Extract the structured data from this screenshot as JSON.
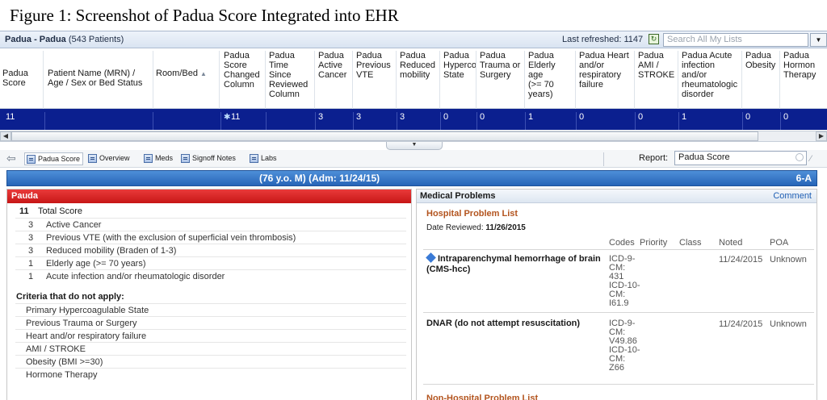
{
  "caption": "Figure 1: Screenshot of Padua Score Integrated into EHR",
  "list": {
    "title": "Padua - Padua",
    "count": "(543 Patients)",
    "last_refreshed_label": "Last refreshed:",
    "last_refreshed_value": "1147",
    "search_placeholder": "Search All My Lists"
  },
  "columns": [
    "Padua\nScore",
    "Patient Name (MRN) /\nAge / Sex or Bed Status",
    "Room/Bed",
    "Padua\nScore\nChanged\nColumn",
    "Padua\nTime\nSince\nReviewed\nColumn",
    "Padua\nActive\nCancer",
    "Padua\nPrevious\nVTE",
    "Padua\nReduced\nmobility",
    "Padua\nHyperco\nState",
    "Padua\nTrauma or\nSurgery",
    "Padua\nElderly age\n(>= 70\nyears)",
    "Padua Heart\nand/or\nrespiratory\nfailure",
    "Padua\nAMI /\nSTROKE",
    "Padua Acute\ninfection\nand/or\nrheumatologic\ndisorder",
    "Padua\nObesity",
    "Padua\nHormon\nTherapy"
  ],
  "row": {
    "score": "11",
    "patient": "",
    "room": "",
    "changed": "11",
    "time_since": "",
    "active_cancer": "3",
    "previous_vte": "3",
    "reduced_mobility": "3",
    "hyperco": "0",
    "trauma": "0",
    "elderly": "1",
    "heart": "0",
    "ami": "0",
    "acute_infection": "1",
    "obesity": "0",
    "hormone": "0"
  },
  "tabs": [
    {
      "label": "Padua Score",
      "active": true
    },
    {
      "label": "Overview"
    },
    {
      "label": "Meds"
    },
    {
      "label": "Signoff Notes"
    },
    {
      "label": "Labs"
    }
  ],
  "report": {
    "label": "Report:",
    "value": "Padua Score"
  },
  "banner": {
    "patient_info": "(76 y.o. M)  (Adm: 11/24/15)",
    "room": "6-A"
  },
  "padua_panel": {
    "title": "Pauda",
    "total_score": "11",
    "total_label": "Total Score",
    "scored_items": [
      {
        "points": "3",
        "label": "Active Cancer"
      },
      {
        "points": "3",
        "label": "Previous VTE (with the exclusion of superficial vein thrombosis)"
      },
      {
        "points": "3",
        "label": "Reduced mobility (Braden of 1-3)"
      },
      {
        "points": "1",
        "label": "Elderly age (>= 70 years)"
      },
      {
        "points": "1",
        "label": "Acute infection and/or rheumatologic disorder"
      }
    ],
    "criteria_not_apply_label": "Criteria that do not apply:",
    "criteria_not_apply": [
      "Primary Hypercoagulable State",
      "Previous Trauma or Surgery",
      "Heart and/or respiratory failure",
      "AMI / STROKE",
      "Obesity (BMI >=30)",
      "Hormone Therapy"
    ]
  },
  "medical_problems": {
    "title": "Medical Problems",
    "comment_link": "Comment",
    "hospital_list_label": "Hospital Problem List",
    "date_reviewed_label": "Date Reviewed:",
    "date_reviewed_value": "11/26/2015",
    "table_headers": [
      "Codes",
      "Priority",
      "Class",
      "Noted",
      "POA"
    ],
    "problems": [
      {
        "name_line1": "Intraparenchymal hemorrhage of brain",
        "name_line2": "(CMS-hcc)",
        "codes": "ICD-9-\nCM:\n431\nICD-10-\nCM:\nI61.9",
        "noted": "11/24/2015",
        "poa": "Unknown"
      },
      {
        "name_line1": "DNAR (do not attempt resuscitation)",
        "name_line2": "",
        "codes": "ICD-9-\nCM:\nV49.86\nICD-10-\nCM:\nZ66",
        "noted": "11/24/2015",
        "poa": "Unknown"
      }
    ],
    "non_hospital_list_label": "Non-Hospital Problem List"
  },
  "icons": {
    "refresh": "refresh-icon",
    "back": "back-arrow-icon",
    "tab": "document-icon",
    "search": "search-icon",
    "diamond": "diamond-icon"
  }
}
